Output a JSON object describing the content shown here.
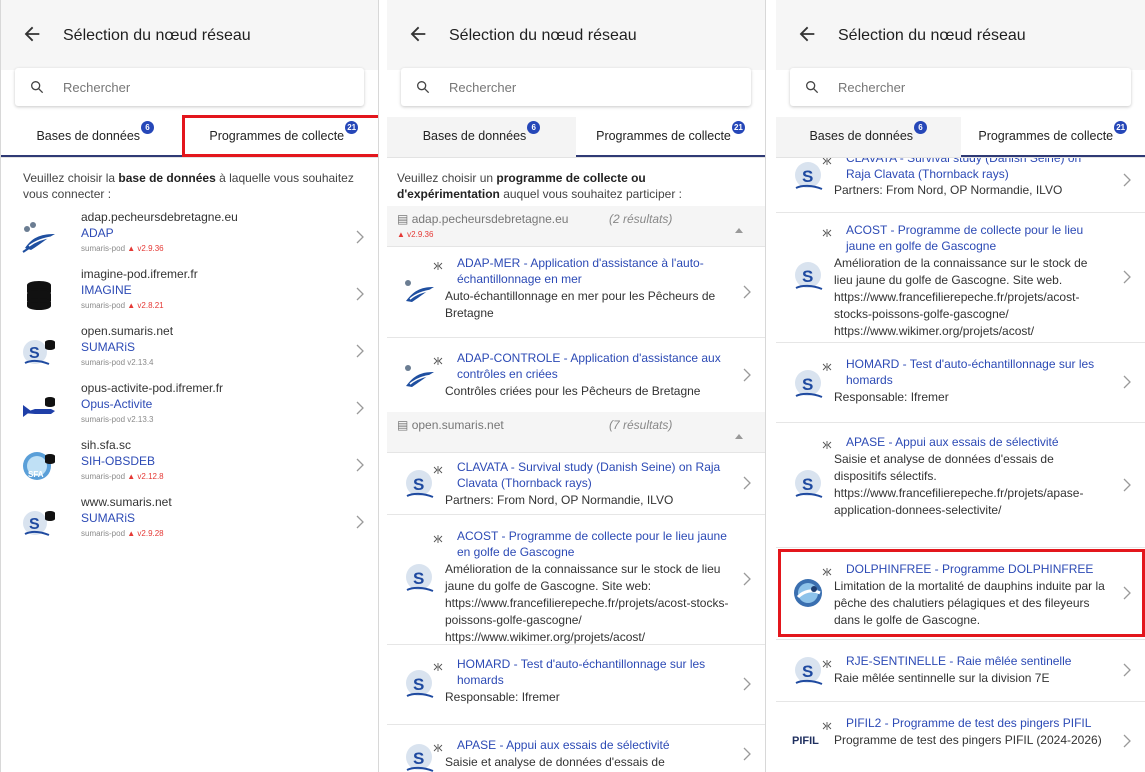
{
  "header": {
    "title": "Sélection du nœud réseau"
  },
  "search": {
    "placeholder": "Rechercher"
  },
  "tabs": {
    "databases": {
      "label": "Bases de données",
      "badge": "6"
    },
    "programs": {
      "label": "Programmes de collecte",
      "badge": "21"
    }
  },
  "panel1": {
    "intro_pre": "Veuillez choisir la ",
    "intro_bold": "base de données",
    "intro_post": " à laquelle vous souhaitez vous connecter :",
    "databases": [
      {
        "host": "adap.pecheursdebretagne.eu",
        "label": "ADAP",
        "pod": "sumaris-pod",
        "version": "v2.9.36",
        "warning": true,
        "icon": "adap-fish-icon"
      },
      {
        "host": "imagine-pod.ifremer.fr",
        "label": "IMAGINE",
        "pod": "sumaris-pod",
        "version": "v2.8.21",
        "warning": true,
        "icon": "database-stack-icon"
      },
      {
        "host": "open.sumaris.net",
        "label": "SUMARiS",
        "pod": "sumaris-pod",
        "version": "v2.13.4",
        "warning": false,
        "icon": "sumaris-logo-icon"
      },
      {
        "host": "opus-activite-pod.ifremer.fr",
        "label": "Opus-Activite",
        "pod": "sumaris-pod",
        "version": "v2.13.3",
        "warning": false,
        "icon": "opus-fish-icon"
      },
      {
        "host": "sih.sfa.sc",
        "label": "SIH-OBSDEB",
        "pod": "sumaris-pod",
        "version": "v2.12.8",
        "warning": true,
        "icon": "sfa-logo-icon"
      },
      {
        "host": "www.sumaris.net",
        "label": "SUMARiS",
        "pod": "sumaris-pod",
        "version": "v2.9.28",
        "warning": true,
        "icon": "sumaris-logo-icon"
      }
    ]
  },
  "panel2": {
    "intro_pre": "Veuillez choisir un ",
    "intro_bold": "programme de collecte ou d'expérimentation",
    "intro_post": " auquel vous souhaitez participer :",
    "groups": [
      {
        "host": "adap.pecheursdebretagne.eu",
        "count": "(2 résultats)",
        "version": "v2.9.36"
      },
      {
        "host": "open.sumaris.net",
        "count": "(7 résultats)",
        "version": ""
      }
    ],
    "programs": [
      {
        "title": "ADAP-MER - Application d'assistance à l'auto-échantillonnage en mer",
        "desc": "Auto-échantillonnage en mer pour les Pêcheurs de Bretagne"
      },
      {
        "title": "ADAP-CONTROLE - Application d'assistance aux contrôles en criées",
        "desc": "Contrôles criées pour les Pêcheurs de Bretagne"
      },
      {
        "title": "CLAVATA - Survival study (Danish Seine) on Raja Clavata (Thornback rays)",
        "desc": "Partners: From Nord, OP Normandie, ILVO"
      },
      {
        "title": "ACOST - Programme de collecte pour le lieu jaune en golfe de Gascogne",
        "desc": "Amélioration de la connaissance sur le stock de lieu jaune du golfe de Gascogne. Site web: https://www.francefilierepeche.fr/projets/acost-stocks-poissons-golfe-gascogne/ https://www.wikimer.org/projets/acost/"
      },
      {
        "title": "HOMARD - Test d'auto-échantillonnage sur les homards",
        "desc": "Responsable: Ifremer"
      },
      {
        "title": "APASE - Appui aux essais de sélectivité",
        "desc": "Saisie et analyse de données d'essais de"
      }
    ]
  },
  "panel3": {
    "programs": [
      {
        "title": "CLAVATA - Survival study (Danish Seine) on Raja Clavata (Thornback rays)",
        "desc": "Partners: From Nord, OP Normandie, ILVO"
      },
      {
        "title": "ACOST - Programme de collecte pour le lieu jaune en golfe de Gascogne",
        "desc": "Amélioration de la connaissance sur le stock de lieu jaune du golfe de Gascogne. Site web. https://www.francefilierepeche.fr/projets/acost-stocks-poissons-golfe-gascogne/ https://www.wikimer.org/projets/acost/"
      },
      {
        "title": "HOMARD - Test d'auto-échantillonnage sur les homards",
        "desc": "Responsable: Ifremer"
      },
      {
        "title": "APASE - Appui aux essais de sélectivité",
        "desc": "Saisie et analyse de données d'essais de dispositifs sélectifs. https://www.francefilierepeche.fr/projets/apase-application-donnees-selectivite/"
      },
      {
        "title": "DOLPHINFREE - Programme DOLPHINFREE",
        "desc": "Limitation de la mortalité de dauphins induite par la pêche des chalutiers pélagiques et des fileyeurs dans le golfe de Gascogne."
      },
      {
        "title": "RJE-SENTINELLE - Raie mêlée sentinelle",
        "desc": "Raie mêlée sentinnelle sur la division 7E"
      },
      {
        "title": "PIFIL2 - Programme de test des pingers PIFIL",
        "desc": "Programme de test des pingers PIFIL (2024-2026)",
        "logo_text": "PIFIL"
      }
    ]
  },
  "colors": {
    "accent": "#2c4ab5",
    "badge": "#2647b8",
    "highlight": "#e3161c",
    "warning": "#e53935"
  }
}
